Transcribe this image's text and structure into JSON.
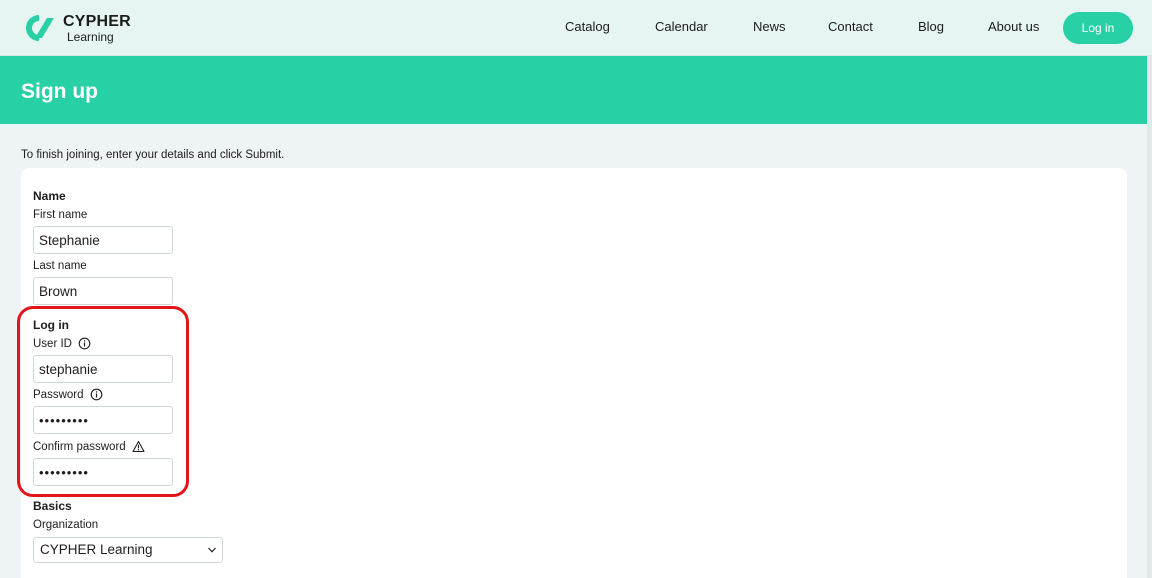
{
  "brand": {
    "name_top": "CYPHER",
    "name_bottom": "Learning",
    "accent_color": "#27d1a5",
    "highlight_color": "#e3151c"
  },
  "nav": {
    "links": [
      {
        "id": "catalog",
        "label": "Catalog"
      },
      {
        "id": "calendar",
        "label": "Calendar"
      },
      {
        "id": "news",
        "label": "News"
      },
      {
        "id": "contact",
        "label": "Contact"
      },
      {
        "id": "blog",
        "label": "Blog"
      },
      {
        "id": "about",
        "label": "About us"
      }
    ],
    "login_label": "Log in"
  },
  "page": {
    "title": "Sign up",
    "intro": "To finish joining, enter your details and click Submit."
  },
  "form": {
    "name_section": {
      "title": "Name",
      "first_name_label": "First name",
      "first_name_value": "Stephanie",
      "last_name_label": "Last name",
      "last_name_value": "Brown"
    },
    "login_section": {
      "title": "Log in",
      "user_id_label": "User ID",
      "user_id_icon": "info-icon",
      "user_id_value": "stephanie",
      "password_label": "Password",
      "password_icon": "info-icon",
      "password_value": "•••••••••",
      "confirm_password_label": "Confirm password",
      "confirm_password_icon": "warning-icon",
      "confirm_password_value": "•••••••••"
    },
    "basics_section": {
      "title": "Basics",
      "organization_label": "Organization",
      "organization_value": "CYPHER Learning"
    }
  }
}
